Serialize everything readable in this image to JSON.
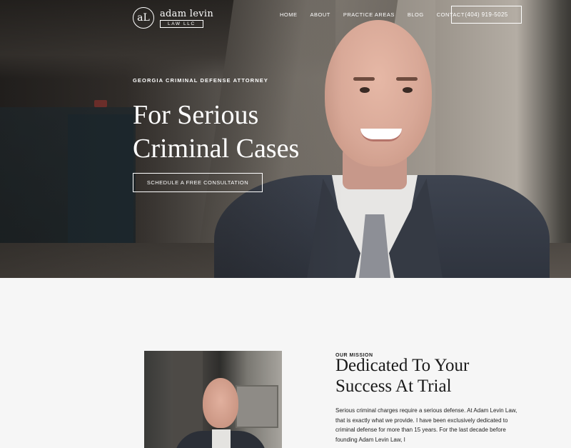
{
  "brand": {
    "mark": "aL",
    "name": "adam levin",
    "sub": "LAW LLC"
  },
  "nav": {
    "items": [
      "HOME",
      "ABOUT",
      "PRACTICE AREAS",
      "BLOG",
      "CONTACT"
    ],
    "phone": "(404) 919-5025"
  },
  "hero": {
    "eyebrow": "GEORGIA CRIMINAL DEFENSE ATTORNEY",
    "title_line1": "For Serious",
    "title_line2": "Criminal Cases",
    "cta": "SCHEDULE A FREE CONSULTATION"
  },
  "mission": {
    "eyebrow": "OUR MISSION",
    "title_line1": "Dedicated To Your",
    "title_line2": "Success At Trial",
    "body": "Serious criminal charges require a serious defense. At Adam Levin Law, that is exactly what we provide.  I have been exclusively dedicated to criminal defense for more than 15 years. For the last decade before founding Adam Levin Law, I"
  },
  "colors": {
    "page_bg": "#f6f6f6",
    "hero_text": "#ffffff",
    "body_text": "#1c1c1c"
  }
}
